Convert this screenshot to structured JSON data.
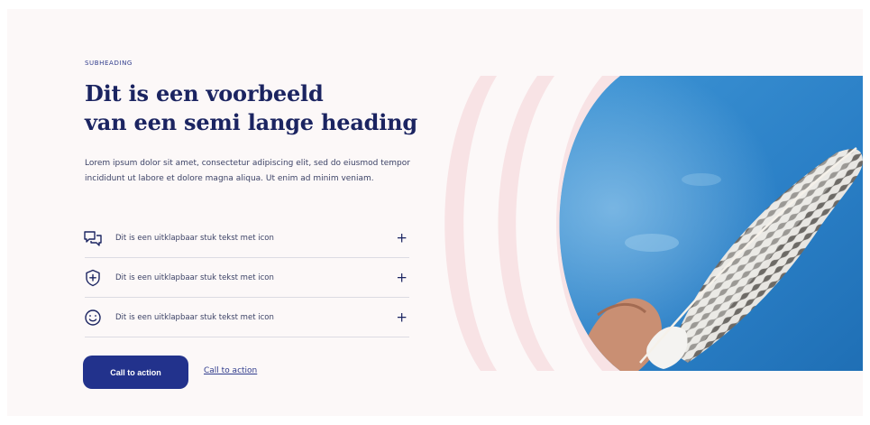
{
  "subheading": "SUBHEADING",
  "heading": {
    "line1": "Dit is een voorbeeld",
    "line2": "van een semi lange heading"
  },
  "body": "Lorem ipsum dolor sit amet, consectetur adipiscing elit, sed do eiusmod tempor incididunt ut labore et dolore magna aliqua. Ut enim ad minim veniam.",
  "accordion": {
    "items": [
      {
        "icon": "chat-bubbles-icon",
        "label": "Dit is een uitklapbaar stuk tekst met icon",
        "toggle": "+"
      },
      {
        "icon": "shield-plus-icon",
        "label": "Dit is een uitklapbaar stuk tekst met icon",
        "toggle": "+"
      },
      {
        "icon": "smiley-icon",
        "label": "Dit is een uitklapbaar stuk tekst met icon",
        "toggle": "+"
      }
    ]
  },
  "cta": {
    "primary_label": "Call to action",
    "secondary_label": "Call to action"
  },
  "colors": {
    "background": "#fcf8f8",
    "heading": "#1b2461",
    "primary": "#22328c",
    "accent_arc": "#f8e3e5",
    "sky": "#2f86cc"
  }
}
